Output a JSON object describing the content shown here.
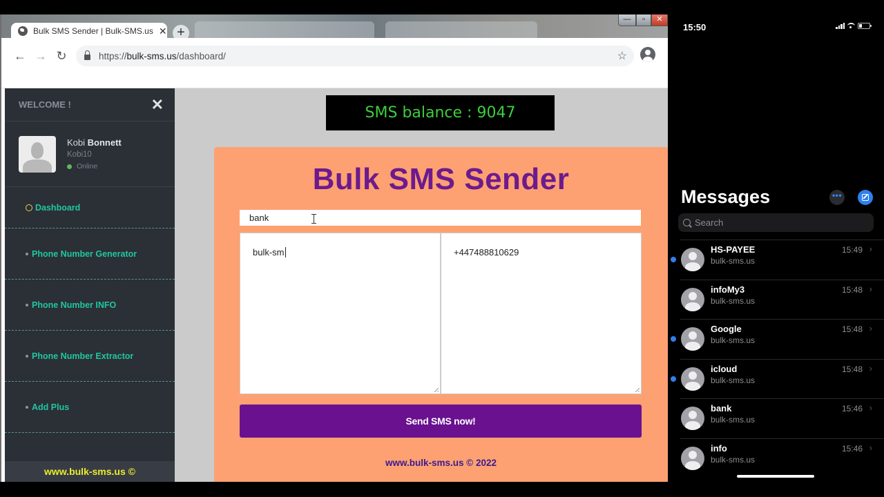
{
  "browser": {
    "tab_title": "Bulk SMS Sender | Bulk-SMS.us",
    "tab_close": "✕",
    "new_tab": "+",
    "window_controls": {
      "minimize": "—",
      "maximize": "▫",
      "close": "✕"
    },
    "nav": {
      "back": "←",
      "forward": "→",
      "reload": "↻"
    },
    "url_prefix": "https://",
    "url_domain": "bulk-sms.us",
    "url_path": "/dashboard/",
    "bookmark_icon": "☆",
    "menu_icon": "⋮"
  },
  "sidebar": {
    "welcome": "WELCOME !",
    "close": "✕",
    "user": {
      "first_name": "Kobi",
      "last_name": "Bonnett",
      "handle": "Kobi10",
      "status": "Online",
      "status_color": "#5cb85c"
    },
    "items": [
      {
        "label": "Dashboard",
        "active": true
      },
      {
        "label": "Phone Number Generator"
      },
      {
        "label": "Phone Number INFO"
      },
      {
        "label": "Phone Number Extractor"
      },
      {
        "label": "Add Plus"
      }
    ],
    "footer": "www.bulk-sms.us ©"
  },
  "main": {
    "balance_text": "SMS balance : 9047",
    "balance_value": 9047,
    "title": "Bulk SMS Sender",
    "sender_id": "bank",
    "message": "bulk-sm",
    "numbers": "+447488810629",
    "send_button": "Send SMS now!",
    "footer": "www.bulk-sms.us © 2022",
    "colors": {
      "card": "#fda172",
      "accent": "#6a1190",
      "title": "#6d1a8e"
    }
  },
  "phone": {
    "time": "15:50",
    "title": "Messages",
    "more_icon": "•••",
    "search_placeholder": "Search",
    "conversations": [
      {
        "name": "HS-PAYEE",
        "preview": "bulk-sms.us",
        "time": "15:49",
        "unread": true
      },
      {
        "name": "infoMy3",
        "preview": "bulk-sms.us",
        "time": "15:48",
        "unread": false
      },
      {
        "name": "Google",
        "preview": "bulk-sms.us",
        "time": "15:48",
        "unread": true
      },
      {
        "name": "icloud",
        "preview": "bulk-sms.us",
        "time": "15:48",
        "unread": true
      },
      {
        "name": "bank",
        "preview": "bulk-sms.us",
        "time": "15:46",
        "unread": false
      },
      {
        "name": "info",
        "preview": "bulk-sms.us",
        "time": "15:46",
        "unread": false
      }
    ],
    "chevron": "›"
  }
}
